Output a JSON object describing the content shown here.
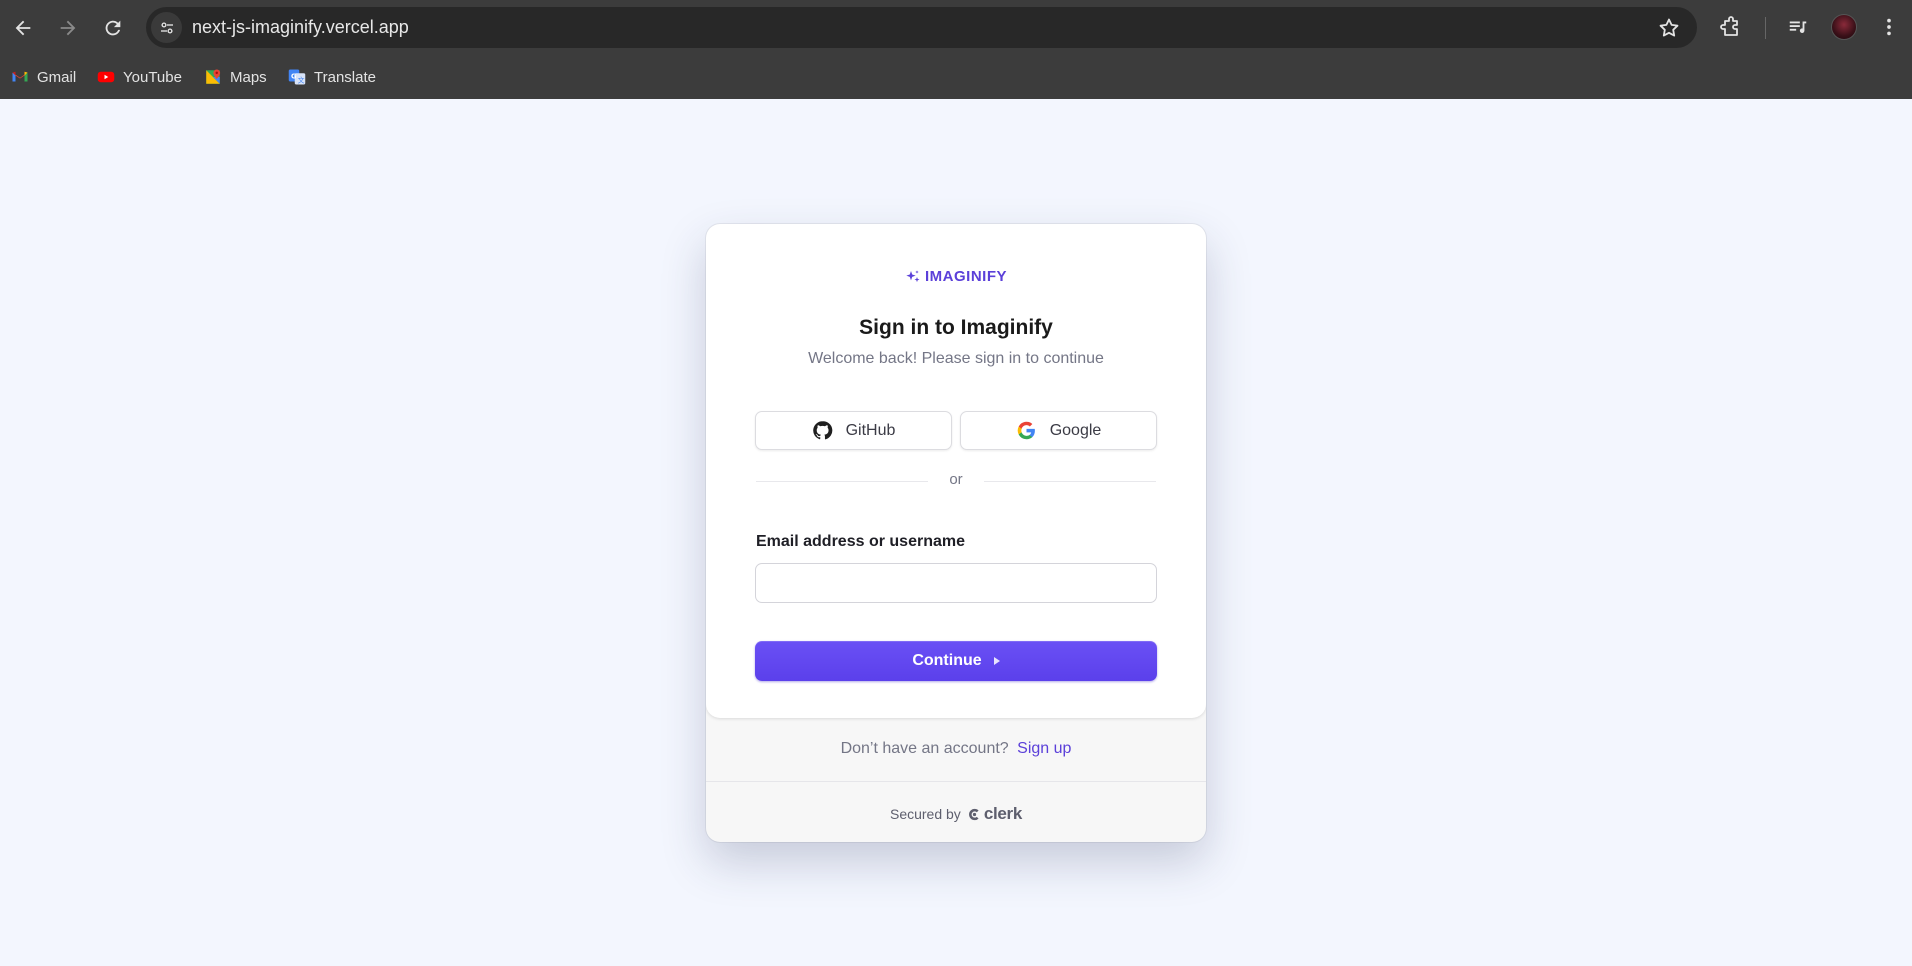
{
  "browser": {
    "url": "next-js-imaginify.vercel.app",
    "bookmarks": [
      {
        "label": "Gmail",
        "icon": "gmail-icon"
      },
      {
        "label": "YouTube",
        "icon": "youtube-icon"
      },
      {
        "label": "Maps",
        "icon": "maps-icon"
      },
      {
        "label": "Translate",
        "icon": "translate-icon"
      }
    ]
  },
  "signin": {
    "logo_text": "IMAGINIFY",
    "title": "Sign in to Imaginify",
    "subtitle": "Welcome back! Please sign in to continue",
    "github_label": "GitHub",
    "google_label": "Google",
    "or_label": "or",
    "email_label": "Email address or username",
    "email_value": "",
    "continue_label": "Continue",
    "no_account_text": "Don’t have an account?",
    "signup_label": "Sign up",
    "secured_by": "Secured by",
    "clerk_label": "clerk"
  },
  "colors": {
    "accent": "#5b40eb",
    "page_bg": "#f3f6fe",
    "chrome_bg": "#3c3c3c"
  }
}
